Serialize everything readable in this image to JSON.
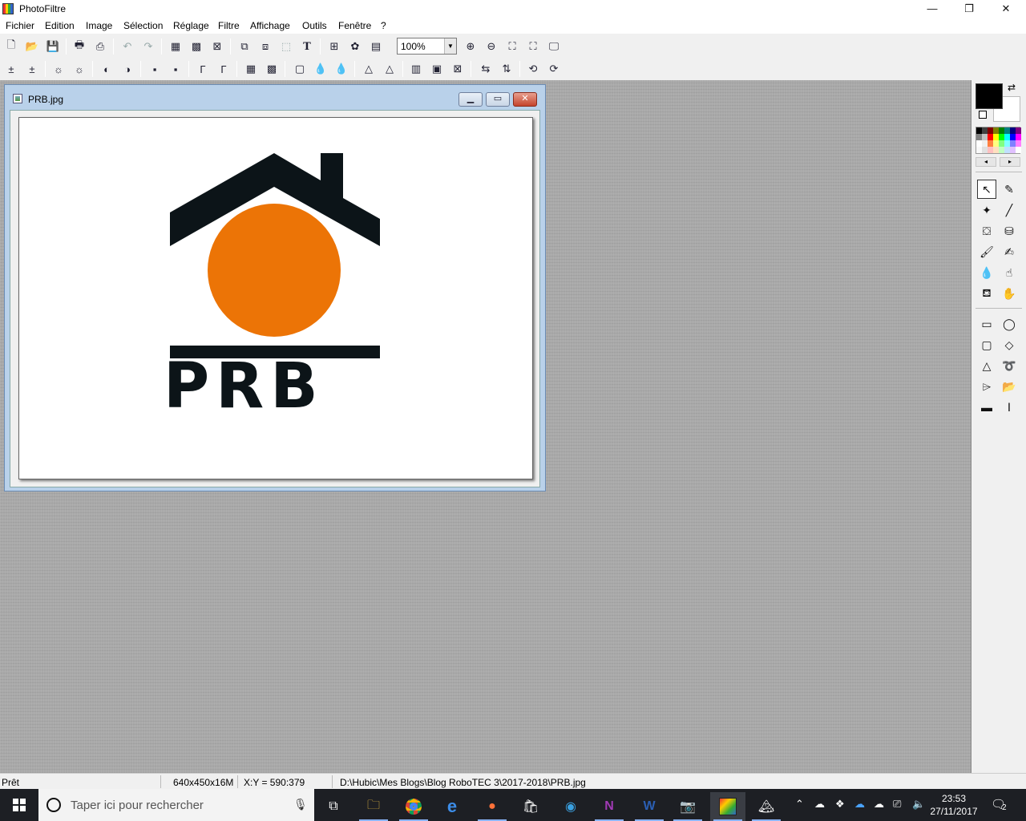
{
  "window": {
    "title": "PhotoFiltre",
    "minimize": "—",
    "restore": "❐",
    "close": "✕"
  },
  "menu": [
    "Fichier",
    "Edition",
    "Image",
    "Sélection",
    "Réglage",
    "Filtre",
    "Affichage",
    "Outils",
    "Fenêtre",
    "?"
  ],
  "toolbar": {
    "zoom_value": "100%"
  },
  "document": {
    "title": "PRB.jpg",
    "image_text": "PRB",
    "colors": {
      "roof": "#0c1418",
      "sun": "#ec7406",
      "text": "#0c1418"
    }
  },
  "palette_colors": [
    "#000000",
    "#404040",
    "#800000",
    "#808000",
    "#008000",
    "#008080",
    "#000080",
    "#800080",
    "#808080",
    "#c0c0c0",
    "#ff0000",
    "#ffff00",
    "#00ff00",
    "#00ffff",
    "#0000ff",
    "#ff00ff",
    "#ffffff",
    "#f0f0f0",
    "#ff8040",
    "#ffff80",
    "#80ff80",
    "#80ffff",
    "#8080ff",
    "#ff80ff",
    "#f8f8f8",
    "#e0e0e0",
    "#ffc0c0",
    "#ffe0c0",
    "#c0ffc0",
    "#c0e0ff",
    "#e0c0ff",
    "#ffffff"
  ],
  "status": {
    "state": "Prêt",
    "size": "640x450x16M",
    "coords": "X:Y = 590:379",
    "path": "D:\\Hubic\\Mes Blogs\\Blog RoboTEC 3\\2017-2018\\PRB.jpg"
  },
  "taskbar": {
    "search_placeholder": "Taper ici pour rechercher",
    "time": "23:53",
    "date": "27/11/2017",
    "notification_count": "2"
  }
}
